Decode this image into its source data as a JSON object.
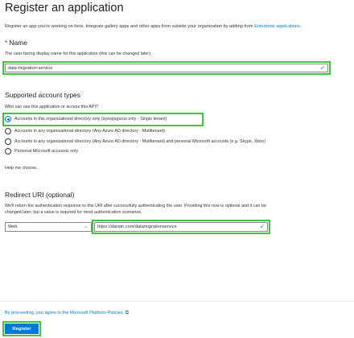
{
  "page": {
    "title": "Register an application",
    "intro_text": "Register an app you're working on here. Integrate gallery apps and other apps from outside your organization by adding from ",
    "intro_link": "Enterprise applications",
    "intro_end": "."
  },
  "name_section": {
    "required_mark": "*",
    "title": "Name",
    "help_text": "The user-facing display name for this application (this can be changed later).",
    "value": "data-migration-service"
  },
  "account_types": {
    "title": "Supported account types",
    "question": "Who can use this application or access this API?",
    "options": [
      {
        "label": "Accounts in this organizational directory only (sysopsgurus only - Single tenant)",
        "checked": true
      },
      {
        "label": "Accounts in any organizational directory (Any Azure AD directory - Multitenant)",
        "checked": false
      },
      {
        "label": "Accounts in any organizational directory (Any Azure AD directory - Multitenant) and personal Microsoft accounts (e.g. Skype, Xbox)",
        "checked": false
      },
      {
        "label": "Personal Microsoft accounts only",
        "checked": false
      }
    ],
    "help_link": "Help me choose..."
  },
  "redirect": {
    "title": "Redirect URI (optional)",
    "help_line1": "We'll return the authentication response to this URI after successfully authenticating the user. Providing this now is optional and it can be",
    "help_line2": "changed later, but a value is required for most authentication scenarios.",
    "platform_value": "Web",
    "uri_value": "https://darwin.com/datamigrationservice"
  },
  "footer": {
    "policy_text": "By proceeding, you agree to the Microsoft Platform Policies",
    "register_label": "Register"
  },
  "colors": {
    "accent": "#0078d4",
    "highlight": "#3ec63e",
    "valid_check": "#107c10",
    "required": "#a4262c"
  },
  "icons": {
    "valid": "checkmark-icon",
    "dropdown": "chevron-down-icon",
    "external": "open-in-new-icon"
  }
}
